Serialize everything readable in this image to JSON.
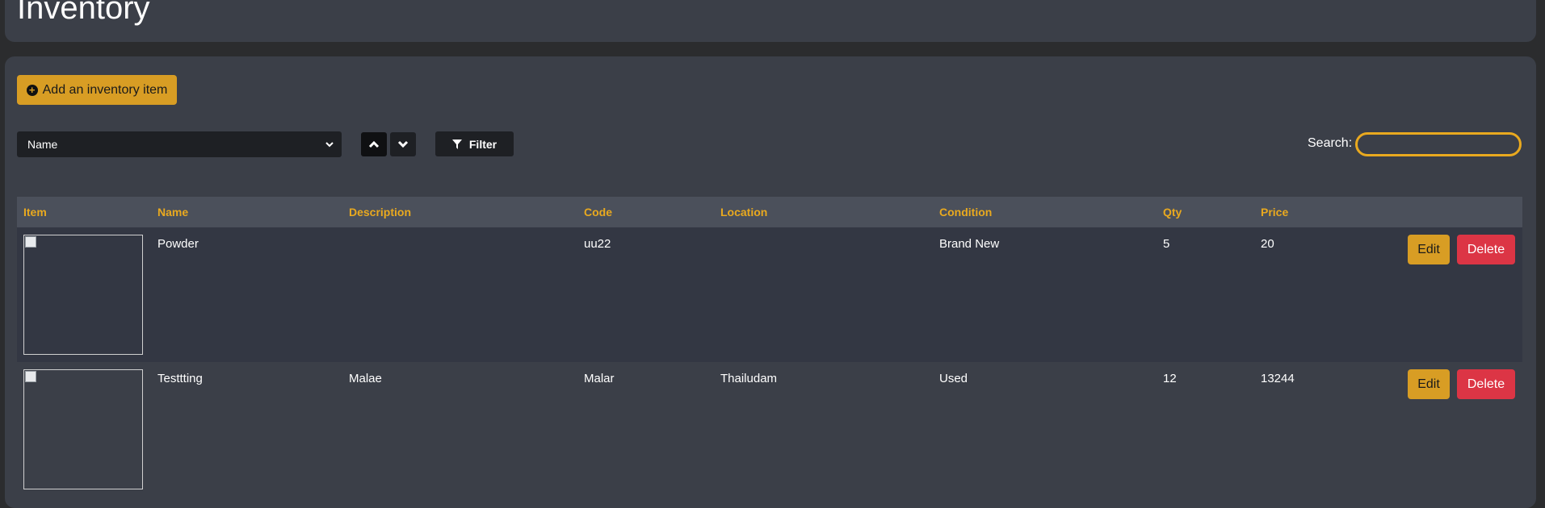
{
  "page": {
    "title": "Inventory"
  },
  "toolbar": {
    "add_label": "Add an inventory item",
    "sort_selected": "Name",
    "filter_label": "Filter",
    "search_label": "Search:",
    "search_value": ""
  },
  "table": {
    "headers": [
      "Item",
      "Name",
      "Description",
      "Code",
      "Location",
      "Condition",
      "Qty",
      "Price"
    ],
    "rows": [
      {
        "name": "Powder",
        "description": "",
        "code": "uu22",
        "location": "",
        "condition": "Brand New",
        "qty": "5",
        "price": "20"
      },
      {
        "name": "Testtting",
        "description": "Malae",
        "code": "Malar",
        "location": "Thailudam",
        "condition": "Used",
        "qty": "12",
        "price": "13244"
      }
    ],
    "edit_label": "Edit",
    "delete_label": "Delete"
  },
  "colors": {
    "accent": "#d89d24",
    "header_text": "#e9a91f",
    "danger": "#dc3545",
    "panel": "#3b3f48"
  },
  "icons": {
    "add": "plus-circle-icon",
    "sort_asc": "chevron-up-icon",
    "sort_desc": "chevron-down-icon",
    "filter": "filter-icon"
  }
}
